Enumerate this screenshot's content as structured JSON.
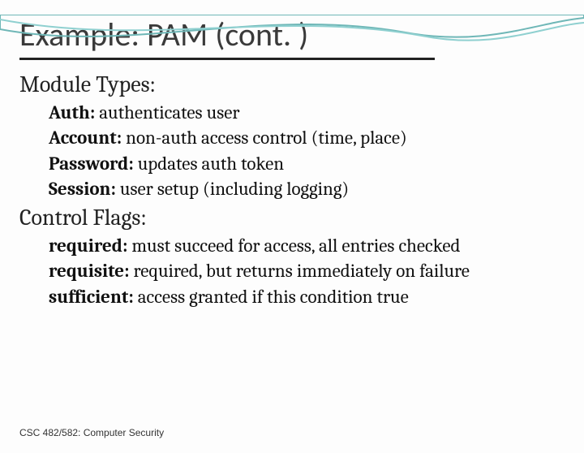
{
  "title": "Example: PAM (cont. )",
  "sections": [
    {
      "heading": "Module Types:",
      "items": [
        {
          "label": "Auth:",
          "desc": " authenticates user"
        },
        {
          "label": "Account:",
          "desc": " non-auth access control (time, place)"
        },
        {
          "label": "Password:",
          "desc": " updates auth token"
        },
        {
          "label": "Session:",
          "desc": " user setup (including logging)"
        }
      ]
    },
    {
      "heading": "Control Flags:",
      "items": [
        {
          "label": "required:",
          "desc": " must succeed for access, all entries checked"
        },
        {
          "label": "requisite:",
          "desc": " required, but returns immediately on failure"
        },
        {
          "label": "sufficient:",
          "desc": " access granted if this condition true"
        }
      ]
    }
  ],
  "footer": "CSC 482/582: Computer Security"
}
